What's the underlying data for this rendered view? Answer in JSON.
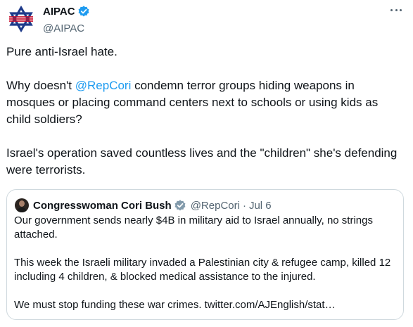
{
  "author": {
    "name": "AIPAC",
    "handle": "@AIPAC",
    "avatar_icon": "aipac-star-logo-icon",
    "verified_icon": "verified-badge-icon"
  },
  "more_icon": "more-options-icon",
  "tweet": {
    "line1": "Pure anti-Israel hate.",
    "para2_prefix": "Why doesn't ",
    "para2_mention": "@RepCori",
    "para2_suffix": " condemn terror groups hiding weapons in mosques or placing command centers next to schools or using kids as child soldiers?",
    "para3": "Israel's operation saved countless lives and the \"children\" she's defending were terrorists."
  },
  "quote": {
    "name": "Congresswoman Cori Bush",
    "handle": "@RepCori",
    "separator": "·",
    "date": "Jul 6",
    "para1": "Our government sends nearly $4B in military aid to Israel annually, no strings attached.",
    "para2": "This week the Israeli military invaded a Palestinian city & refugee camp, killed 12 including 4 children, & blocked medical assistance to the injured.",
    "para3": "We must stop funding these war crimes. twitter.com/AJEnglish/stat…"
  },
  "colors": {
    "link": "#1d9bf0",
    "secondary_text": "#536471",
    "primary_text": "#0f1419",
    "border": "#cfd9de",
    "logo_blue": "#1e3a8a",
    "logo_red": "#c8102e"
  }
}
